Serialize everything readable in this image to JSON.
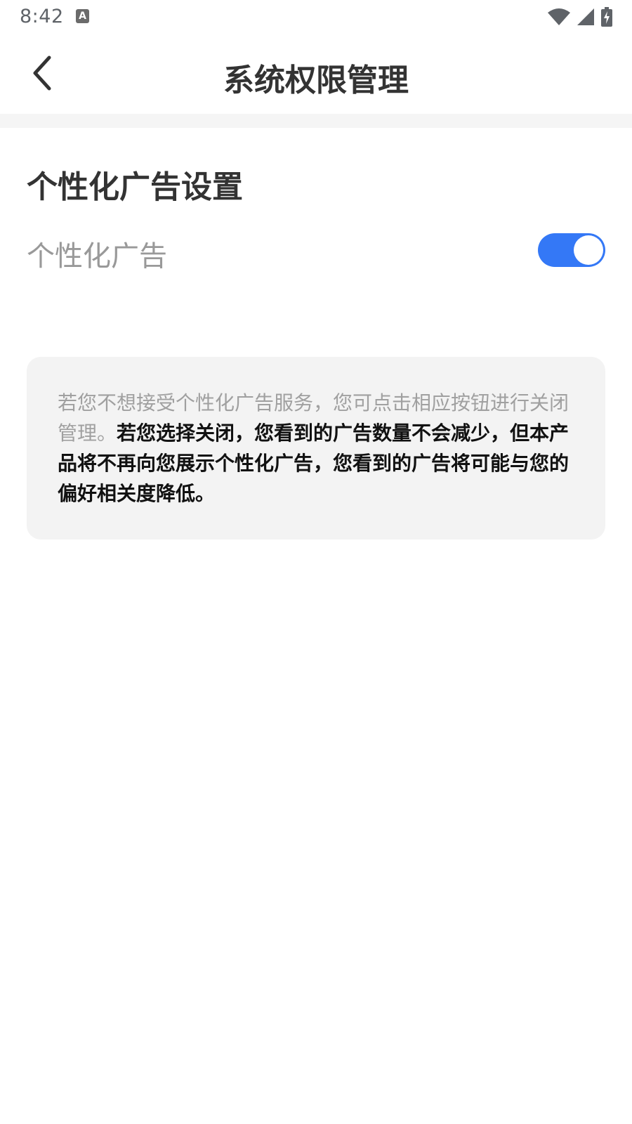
{
  "status_bar": {
    "time": "8:42",
    "notification_icon": "a-badge-icon",
    "notification_glyph": "A",
    "icons": [
      "wifi-icon",
      "signal-icon",
      "battery-charging-icon"
    ]
  },
  "header": {
    "title": "系统权限管理",
    "back_icon": "chevron-left-icon"
  },
  "section": {
    "title": "个性化广告设置",
    "setting": {
      "label": "个性化广告",
      "toggle_on": true,
      "toggle_color": "#3478f6"
    }
  },
  "info": {
    "normal_text": "若您不想接受个性化广告服务，您可点击相应按钮进行关闭管理。",
    "bold_text": "若您选择关闭，您看到的广告数量不会减少，但本产品将不再向您展示个性化广告，您看到的广告将可能与您的偏好相关度降低。"
  }
}
